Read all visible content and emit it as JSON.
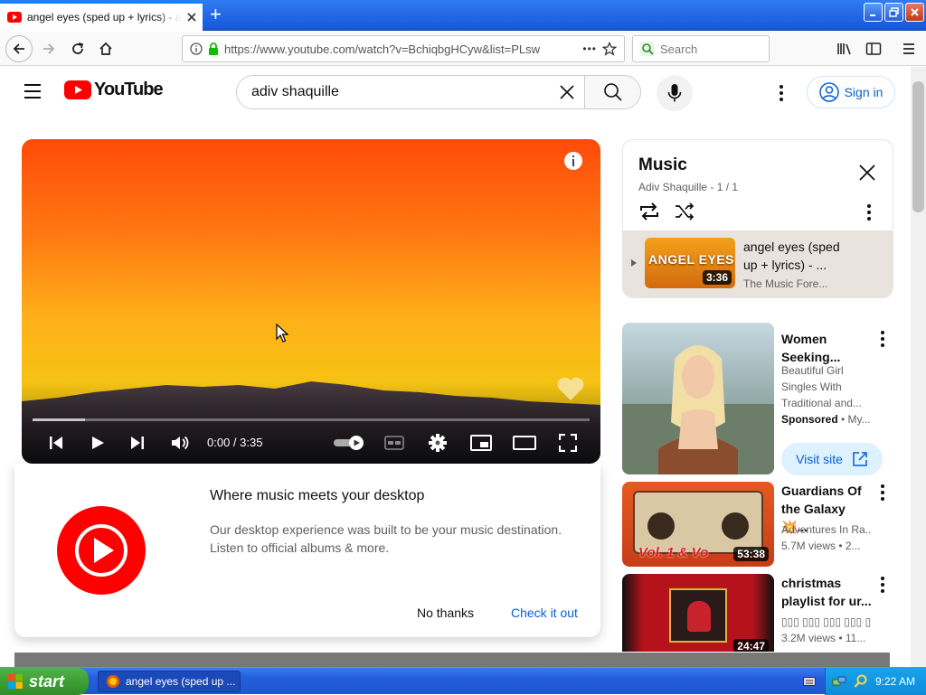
{
  "browser": {
    "tab_title": "angel eyes (sped up + lyrics) - adiv shaquille",
    "new_tab_symbol": "+",
    "url": "https://www.youtube.com/watch?v=BchiqbgHCyw&list=PLsw",
    "url_more": "•••",
    "search_placeholder": "Search"
  },
  "youtube": {
    "logo_text": "YouTube",
    "search_value": "adiv shaquille",
    "signin_label": "Sign in"
  },
  "player": {
    "time": "0:00 / 3:35",
    "progress_fraction": 0
  },
  "promo": {
    "heading": "Where music meets your desktop",
    "description": "Our desktop experience was built to be your music destination. Listen to official albums & more.",
    "no_thanks": "No thanks",
    "check_it_out": "Check it out"
  },
  "playlist": {
    "title": "Music",
    "subtitle": "Adiv Shaquille - 1 / 1",
    "item": {
      "thumb_text": "ANGEL EYES",
      "title": "angel eyes (sped up + lyrics) - ...",
      "channel": "The Music Fore...",
      "duration": "3:36"
    }
  },
  "recommendations": [
    {
      "title": "Women Seeking...",
      "meta1": "Beautiful Girl Singles With Traditional and...",
      "sponsored": "Sponsored",
      "meta2": "• My...",
      "visit_label": "Visit site"
    },
    {
      "title": "Guardians Of the Galaxy 💥...",
      "channel": "Adventures In Ra...",
      "stats": "5.7M views  • 2...",
      "duration": "53:38",
      "thumb_text": "Vol. 1 & Vo"
    },
    {
      "title": "christmas playlist for ur...",
      "channel": "▯▯▯ ▯▯▯ ▯▯▯ ▯▯▯ ▯▯▯",
      "stats": "3.2M views  • 11...",
      "duration": "24:47"
    }
  ],
  "taskbar": {
    "start_label": "start",
    "task_label": "angel eyes (sped up ...",
    "clock": "9:22 AM"
  },
  "colors": {
    "yt_red": "#ff0000",
    "link_blue": "#065fd4",
    "xp_blue": "#245edb"
  }
}
